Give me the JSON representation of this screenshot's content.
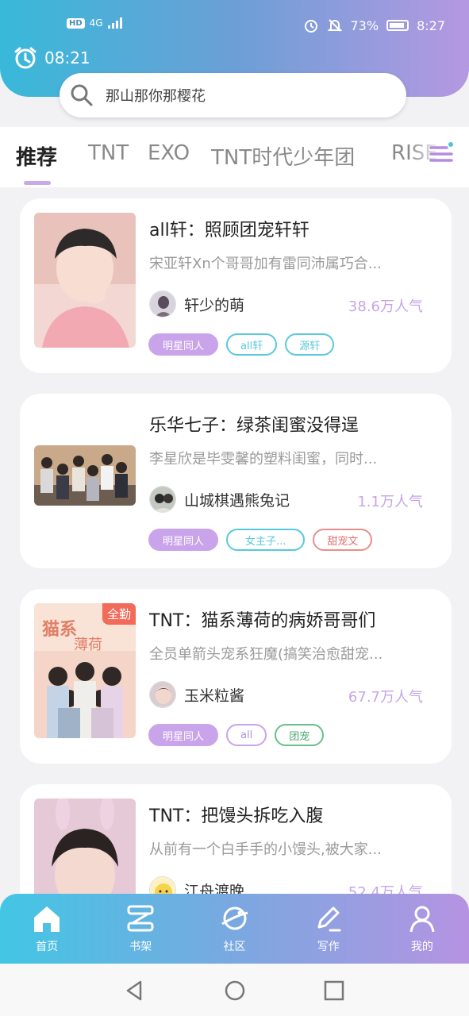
{
  "status_bar": {
    "hd": "HD",
    "network": "4G",
    "battery": "73%",
    "time": "8:27"
  },
  "header": {
    "clock_time": "08:21"
  },
  "search": {
    "placeholder": "那山那你那樱花"
  },
  "tabs": [
    "推荐",
    "TNT",
    "EXO",
    "TNT时代少年团",
    "RISE"
  ],
  "cards": [
    {
      "title": "all轩：照顾团宠轩轩",
      "desc": "宋亚轩Xn个哥哥加有雷同沛属巧合...",
      "author": "轩少的萌",
      "popularity": "38.6万人气",
      "tags": [
        "明星同人",
        "all轩",
        "源轩"
      ]
    },
    {
      "title": "乐华七子：绿茶闺蜜没得逞",
      "desc": "李星欣是毕雯馨的塑料闺蜜，同时...",
      "author": "山城棋遇熊兔记",
      "popularity": "1.1万人气",
      "tags": [
        "明星同人",
        "女主子...",
        "甜宠文"
      ]
    },
    {
      "title": "TNT：猫系薄荷的病娇哥哥们",
      "desc": "全员单箭头宠系狂魔(搞笑治愈甜宠...",
      "author": "玉米粒酱",
      "popularity": "67.7万人气",
      "tags": [
        "明星同人",
        "all",
        "团宠"
      ],
      "badge": "全勤"
    },
    {
      "title": "TNT：把馒头拆吃入腹",
      "desc": "从前有一个白手手的小馒头,被大家...",
      "author": "江舟渡晚",
      "popularity": "52.4万人气"
    }
  ],
  "bottom_nav": [
    "首页",
    "书架",
    "社区",
    "写作",
    "我的"
  ],
  "colors": {
    "accent_purple": "#c9a4ea",
    "gradient_start": "#38b9d9",
    "gradient_end": "#b598e2"
  }
}
